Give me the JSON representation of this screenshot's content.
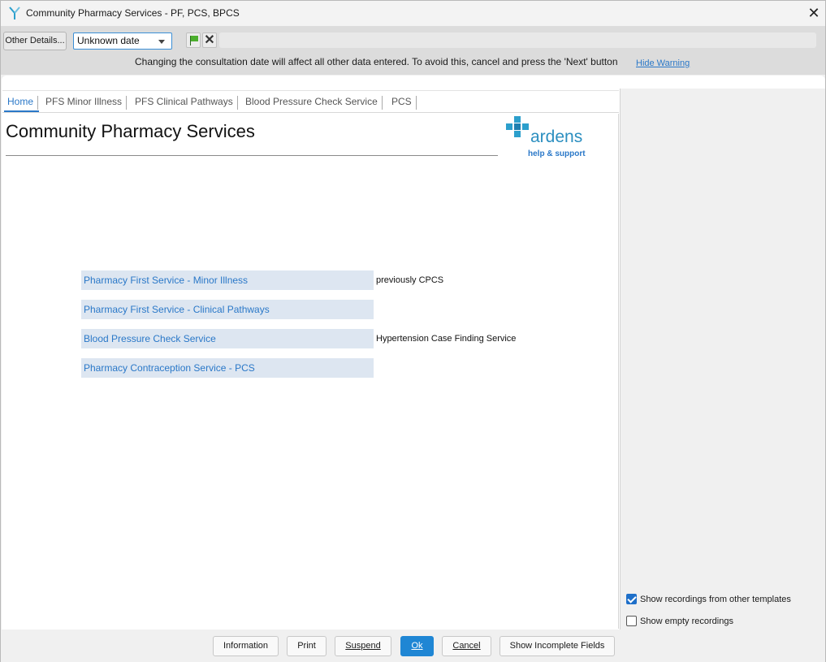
{
  "window": {
    "title": "Community Pharmacy Services - PF, PCS, BPCS",
    "close_glyph": "✕"
  },
  "toolbar": {
    "other_details_label": "Other Details...",
    "date_value": "Unknown date",
    "clear_glyph": "✕",
    "warning_text": "Changing the consultation date will affect all other data entered. To avoid this, cancel and press the 'Next' button",
    "hide_warning_label": "Hide Warning"
  },
  "tabs": [
    {
      "label": "Home",
      "active": true
    },
    {
      "label": "PFS Minor Illness",
      "active": false
    },
    {
      "label": "PFS Clinical Pathways",
      "active": false
    },
    {
      "label": "Blood Pressure Check Service",
      "active": false
    },
    {
      "label": "PCS",
      "active": false
    }
  ],
  "main": {
    "heading": "Community Pharmacy Services",
    "logo_word": "ardens",
    "logo_sub": "help & support",
    "services": [
      {
        "label": "Pharmacy First Service - Minor Illness",
        "note": "previously CPCS"
      },
      {
        "label": "Pharmacy First Service - Clinical Pathways",
        "note": ""
      },
      {
        "label": "Blood Pressure Check Service",
        "note": "Hypertension Case Finding Service"
      },
      {
        "label": "Pharmacy Contraception Service - PCS",
        "note": ""
      }
    ]
  },
  "right_panel": {
    "show_other_templates_label": "Show recordings from other templates",
    "show_other_templates_checked": true,
    "show_empty_label": "Show empty recordings",
    "show_empty_checked": false
  },
  "footer": {
    "information_label": "Information",
    "print_label": "Print",
    "suspend_label": "Suspend",
    "ok_label": "Ok",
    "cancel_label": "Cancel",
    "show_incomplete_label": "Show Incomplete Fields"
  },
  "colors": {
    "accent": "#2a78c8",
    "primary_button": "#1f86d4",
    "link_bg": "#dde6f1",
    "logo_blue": "#2c9fcc"
  }
}
